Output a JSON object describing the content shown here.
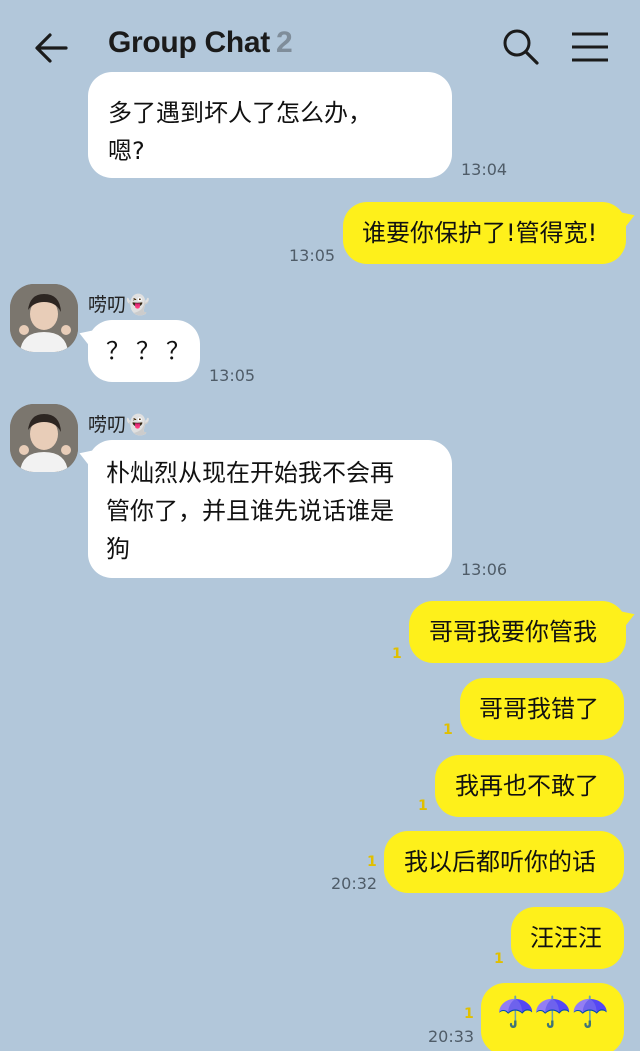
{
  "header": {
    "title": "Group Chat",
    "member_count": "2",
    "back_icon": "arrow-left-icon",
    "search_icon": "search-icon",
    "menu_icon": "hamburger-menu-icon"
  },
  "colors": {
    "background": "#b2c7da",
    "incoming_bubble": "#ffffff",
    "outgoing_bubble": "#fef01b",
    "unread": "#e0bf00"
  },
  "messages": [
    {
      "direction": "in",
      "line1": "多了遇到坏人了怎么办，",
      "line2": "嗯?",
      "time": "13:04"
    },
    {
      "direction": "out",
      "text": "谁要你保护了!管得宽!",
      "time": "13:05"
    },
    {
      "direction": "in",
      "sender": "唠叨👻",
      "text": "？？？",
      "time": "13:05"
    },
    {
      "direction": "in",
      "sender": "唠叨👻",
      "line1": "朴灿烈从现在开始我不会再",
      "line2": "管你了，并且谁先说话谁是",
      "line3": "狗",
      "time": "13:06"
    },
    {
      "direction": "out",
      "text": "哥哥我要你管我",
      "unread": "1"
    },
    {
      "direction": "out",
      "text": "哥哥我错了",
      "unread": "1"
    },
    {
      "direction": "out",
      "text": "我再也不敢了",
      "unread": "1"
    },
    {
      "direction": "out",
      "text": "我以后都听你的话",
      "unread": "1",
      "time": "20:32"
    },
    {
      "direction": "out",
      "text": "汪汪汪",
      "unread": "1"
    },
    {
      "direction": "out",
      "text": "☂️☂️☂️",
      "unread": "1",
      "time": "20:33"
    }
  ]
}
